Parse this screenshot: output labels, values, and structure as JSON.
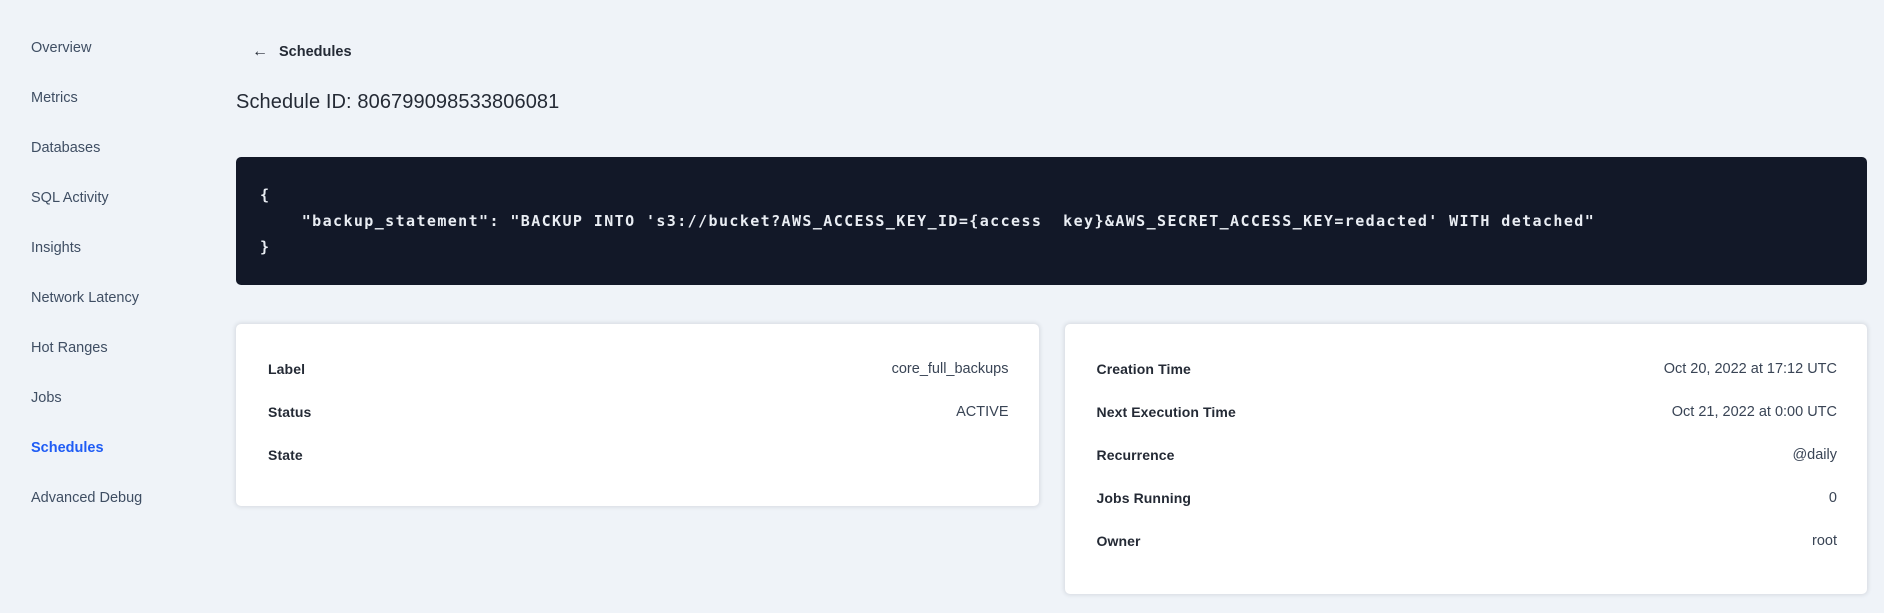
{
  "sidebar": {
    "items": [
      {
        "label": "Overview",
        "active": false
      },
      {
        "label": "Metrics",
        "active": false
      },
      {
        "label": "Databases",
        "active": false
      },
      {
        "label": "SQL Activity",
        "active": false
      },
      {
        "label": "Insights",
        "active": false
      },
      {
        "label": "Network Latency",
        "active": false
      },
      {
        "label": "Hot Ranges",
        "active": false
      },
      {
        "label": "Jobs",
        "active": false
      },
      {
        "label": "Schedules",
        "active": true
      },
      {
        "label": "Advanced Debug",
        "active": false
      }
    ],
    "active_color": "#1f5cf5"
  },
  "header": {
    "back_icon": "←",
    "back_label": "Schedules",
    "title": "Schedule ID: 806799098533806081"
  },
  "code_block": {
    "background_color": "#121828",
    "lines": [
      "{",
      "    \"backup_statement\": \"BACKUP INTO 's3://bucket?AWS_ACCESS_KEY_ID={access  key}&AWS_SECRET_ACCESS_KEY=redacted' WITH detached\"",
      "}"
    ]
  },
  "details_card": {
    "rows": [
      {
        "label": "Label",
        "value": "core_full_backups"
      },
      {
        "label": "Status",
        "value": "ACTIVE"
      },
      {
        "label": "State",
        "value": ""
      }
    ]
  },
  "schedule_card": {
    "rows": [
      {
        "label": "Creation Time",
        "value": "Oct 20, 2022 at 17:12 UTC"
      },
      {
        "label": "Next Execution Time",
        "value": "Oct 21, 2022 at 0:00 UTC"
      },
      {
        "label": "Recurrence",
        "value": "@daily"
      },
      {
        "label": "Jobs Running",
        "value": "0"
      },
      {
        "label": "Owner",
        "value": "root"
      }
    ]
  }
}
